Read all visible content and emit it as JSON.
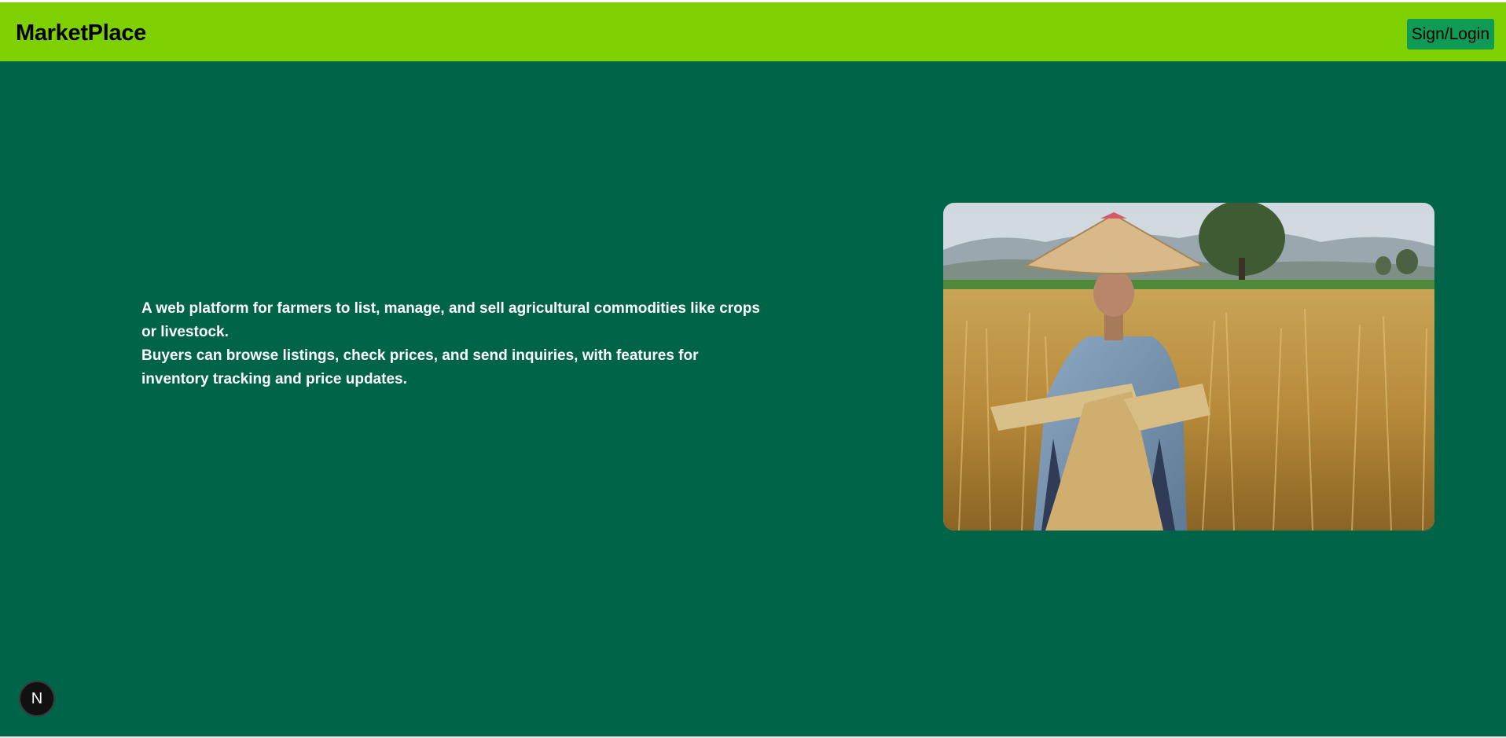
{
  "header": {
    "brand": "MarketPlace",
    "signin_label": "Sign/Login"
  },
  "hero": {
    "paragraph_1": "A web platform for farmers to list, manage, and sell agricultural commodities like crops or livestock.",
    "paragraph_2": "Buyers can browse listings, check prices, and send inquiries, with features for inventory tracking and price updates."
  },
  "dev_badge": {
    "glyph": "N"
  },
  "colors": {
    "navbar": "#7ed000",
    "hero_background": "#006449",
    "signin_button": "#0f9a55",
    "text_on_hero": "#ffffff"
  }
}
